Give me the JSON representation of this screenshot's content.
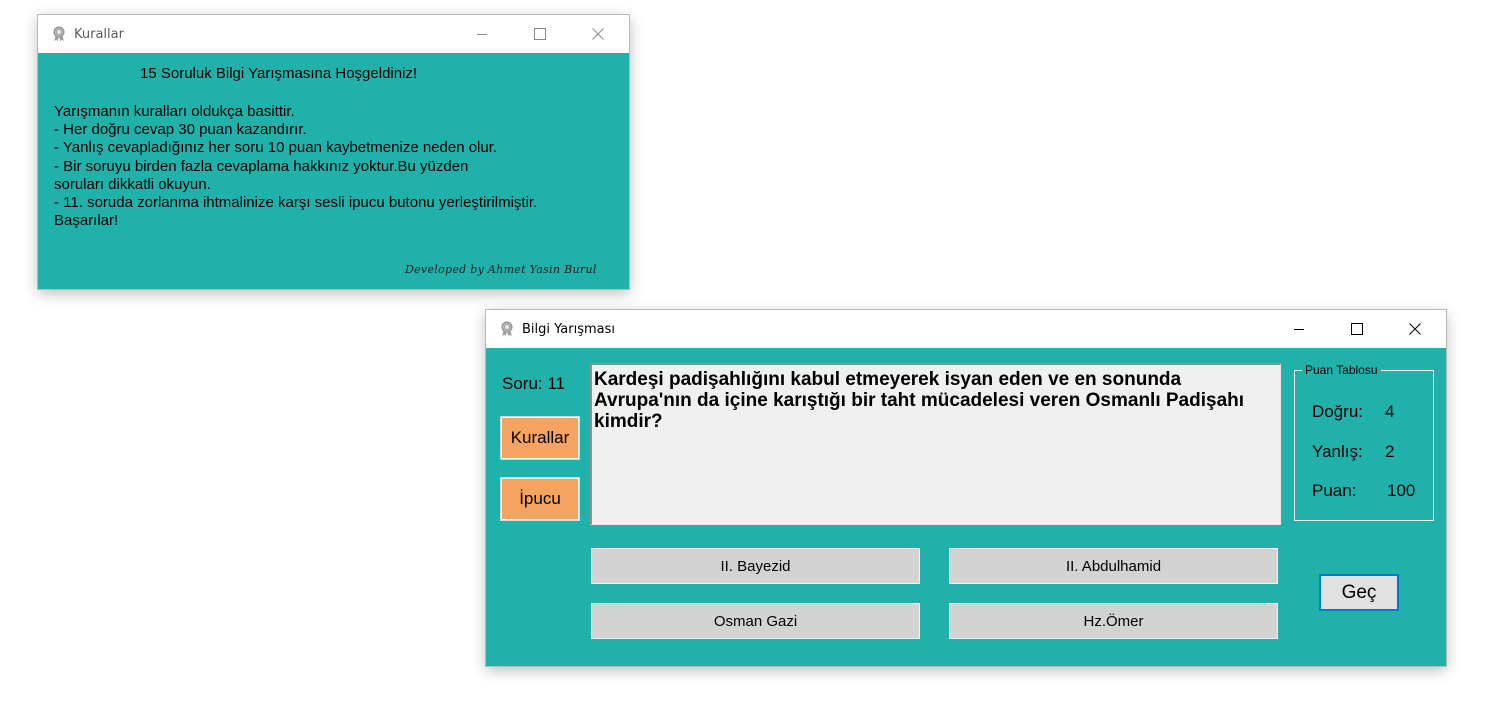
{
  "colors": {
    "form_bg": "#20b2aa",
    "orange_button": "#f4a460",
    "answer_button": "#d3d3d3",
    "focus_border": "#0078d7"
  },
  "rules_window": {
    "title": "Kurallar",
    "heading": "15 Soruluk Bilgi Yarışmasına Hoşgeldiniz!",
    "lines": [
      "Yarışmanın kuralları oldukça basittir.",
      "- Her doğru cevap 30 puan kazandırır.",
      "- Yanlış cevapladığınız her soru 10 puan kaybetmenize neden olur.",
      "- Bir soruyu birden fazla cevaplama hakkınız yoktur.Bu yüzden",
      "soruları dikkatli okuyun.",
      "- 11. soruda zorlanma ihtmalinize karşı sesli ipucu butonu yerleştirilmiştir.",
      "Başarılar!"
    ],
    "credit": "Developed by Ahmet Yasin Burul"
  },
  "quiz_window": {
    "title": "Bilgi Yarışması",
    "question_number": "Soru: 11",
    "rules_button": "Kurallar",
    "hint_button": "İpucu",
    "question_text": "Kardeşi padişahlığını kabul etmeyerek isyan eden ve en sonunda Avrupa'nın da içine karıştığı bir taht mücadelesi veren Osmanlı Padişahı kimdir?",
    "score_table": {
      "title": "Puan Tablosu",
      "correct_label": "Doğru:",
      "correct_value": "4",
      "wrong_label": "Yanlış:",
      "wrong_value": "2",
      "points_label": "Puan:",
      "points_value": "100"
    },
    "answers": [
      "II. Bayezid",
      "II. Abdulhamid",
      "Osman Gazi",
      "Hz.Ömer"
    ],
    "next_button": "Geç"
  },
  "icons": {
    "app": "award-medal-icon",
    "minimize": "minimize-icon",
    "maximize": "maximize-icon",
    "close": "close-icon"
  }
}
